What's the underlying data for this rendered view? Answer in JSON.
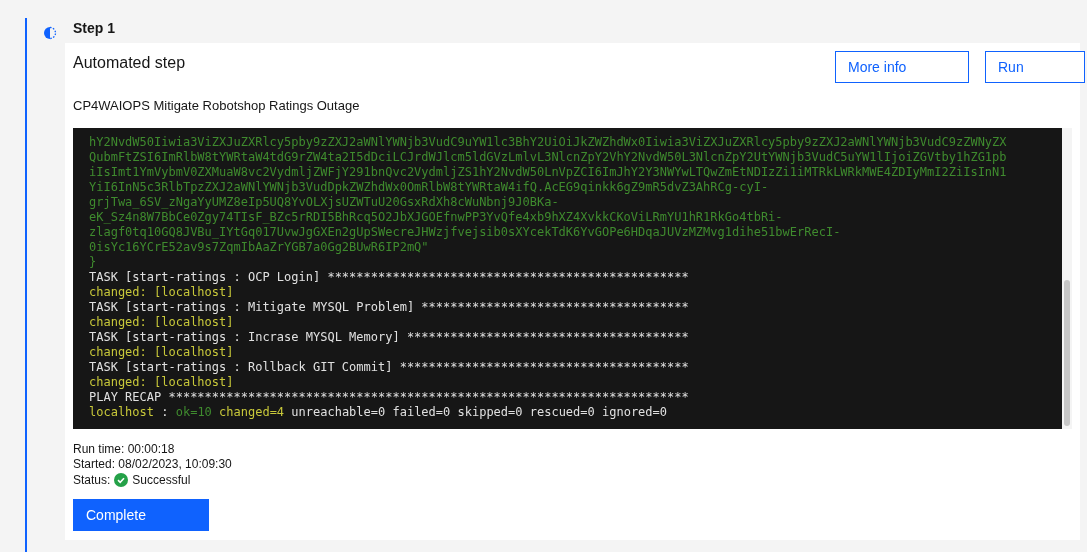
{
  "step": {
    "title": "Step 1",
    "in_progress": true
  },
  "card": {
    "heading": "Automated step",
    "description": "CP4WAIOPS Mitigate Robotshop Ratings Outage",
    "buttons": [
      {
        "label": "More info"
      },
      {
        "label": "Run"
      }
    ],
    "log": [
      [
        {
          "kind": "output",
          "text": "hY2NvdW50Iiwia3ViZXJuZXRlcy5pby9zZXJ2aWNlYWNjb3VudC9uYW1lc3BhY2UiOiJkZWZhdWx0Iiwia3ViZXJuZXRlcy5pby9zZXJ2aWNlYWNjb3VudC9zZWNyZX"
        }
      ],
      [
        {
          "kind": "output",
          "text": "QubmFtZSI6ImRlbW8tYWRtaW4tdG9rZW4ta2I5dDciLCJrdWJlcm5ldGVzLmlvL3NlcnZpY2VhY2NvdW50L3NlcnZpY2UtYWNjb3VudC5uYW1lIjoiZGVtby1hZG1pb"
        }
      ],
      [
        {
          "kind": "output",
          "text": "iIsImt1YmVybmV0ZXMuaW8vc2VydmljZWFjY291bnQvc2VydmljZS1hY2NvdW50LnVpZCI6ImJhY2Y3NWYwLTQwZmEtNDIzZi1iMTRkLWRkMWE4ZDIyMmI2ZiIsInN1"
        }
      ],
      [
        {
          "kind": "output",
          "text": "YiI6InN5c3RlbTpzZXJ2aWNlYWNjb3VudDpkZWZhdWx0OmRlbW8tYWRtaW4ifQ.AcEG9qinkk6gZ9mR5dvZ3AhRCg-cyI-"
        }
      ],
      [
        {
          "kind": "output",
          "text": "grjTwa_6SV_zNgaYyUMZ8eIp5UQ8YvOLXjsUZWTuU20GsxRdXh8cWuNbnj9J0BKa-"
        }
      ],
      [
        {
          "kind": "output",
          "text": "eK_Sz4n8W7BbCe0Zgy74TIsF_BZc5rRDI5BhRcq5O2JbXJGOEfnwPP3YvQfe4xb9hXZ4XvkkCKoViLRmYU1hR1RkGo4tbRi-"
        }
      ],
      [
        {
          "kind": "output",
          "text": "zlagf0tq10GQ8JVBu_IYtGq017UvwJgGXEn2gUpSWecreJHWzjfvejsib0sXYcekTdK6YvGOPe6HDqaJUVzMZMvg1dihe51bwErRecI-"
        }
      ],
      [
        {
          "kind": "output",
          "text": "0isYc16YCrE52av9s7ZqmIbAaZrYGB7a0Gg2BUwR6IP2mQ\""
        }
      ],
      [
        {
          "kind": "output",
          "text": "}"
        }
      ],
      [
        {
          "kind": "plain",
          "text": "TASK [start-ratings : OCP Login] **************************************************"
        }
      ],
      [
        {
          "kind": "changed",
          "text": "changed: [localhost]"
        }
      ],
      [
        {
          "kind": "plain",
          "text": "TASK [start-ratings : Mitigate MYSQL Problem] *************************************"
        }
      ],
      [
        {
          "kind": "changed",
          "text": "changed: [localhost]"
        }
      ],
      [
        {
          "kind": "plain",
          "text": "TASK [start-ratings : Incrase MYSQL Memory] ***************************************"
        }
      ],
      [
        {
          "kind": "changed",
          "text": "changed: [localhost]"
        }
      ],
      [
        {
          "kind": "plain",
          "text": "TASK [start-ratings : Rollback GIT Commit] ****************************************"
        }
      ],
      [
        {
          "kind": "changed",
          "text": "changed: [localhost]"
        }
      ],
      [
        {
          "kind": "plain",
          "text": "PLAY RECAP ************************************************************************"
        }
      ],
      [
        {
          "kind": "changed",
          "text": "localhost"
        },
        {
          "kind": "plain",
          "text": " : "
        },
        {
          "kind": "ok",
          "text": "ok=10"
        },
        {
          "kind": "changed",
          "text": " changed=4"
        },
        {
          "kind": "plain",
          "text": " unreachable=0 failed=0 skipped=0 rescued=0 ignored=0"
        }
      ]
    ],
    "run_time": "Run time: 00:00:18",
    "started": "Started: 08/02/2023, 10:09:30",
    "status": {
      "label": "Status:",
      "value": "Successful",
      "kind": "success"
    },
    "complete_button": "Complete"
  }
}
